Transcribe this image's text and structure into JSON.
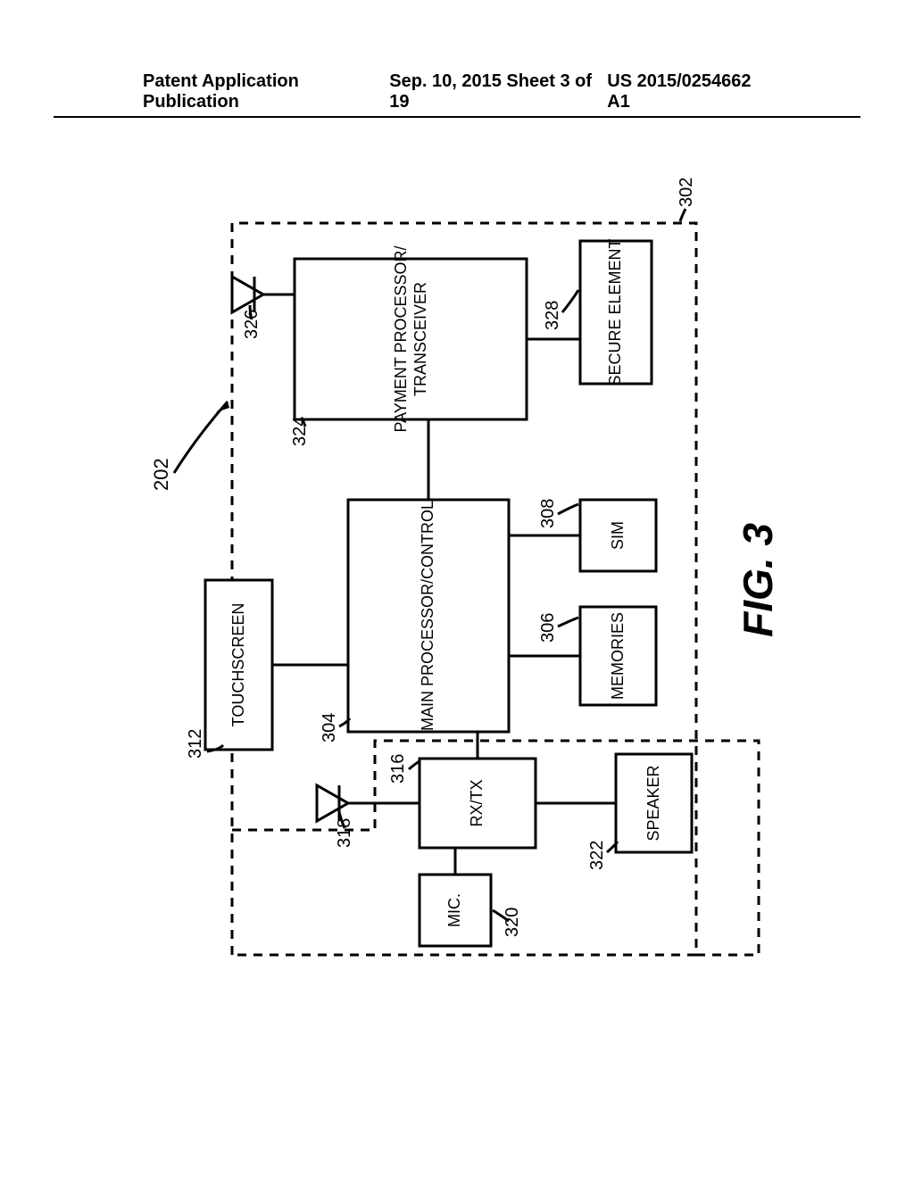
{
  "header": {
    "left": "Patent Application Publication",
    "center": "Sep. 10, 2015  Sheet 3 of 19",
    "right": "US 2015/0254662 A1"
  },
  "figure": {
    "caption": "FIG. 3",
    "overall_ref": "202",
    "sub_ref": "302",
    "blocks": {
      "mic": {
        "label": "MIC.",
        "ref": "320"
      },
      "rxtx": {
        "label": "RX/TX",
        "ref": "316"
      },
      "antenna1_ref": "318",
      "speaker": {
        "label": "SPEAKER",
        "ref": "322"
      },
      "touchscreen": {
        "label": "TOUCHSCREEN",
        "ref": "312"
      },
      "mainproc": {
        "label": "MAIN PROCESSOR/CONTROL",
        "ref": "304"
      },
      "memories": {
        "label": "MEMORIES",
        "ref": "306"
      },
      "sim": {
        "label": "SIM",
        "ref": "308"
      },
      "payproc": {
        "label1": "PAYMENT PROCESSOR/",
        "label2": "TRANSCEIVER",
        "ref": "324"
      },
      "antenna2_ref": "326",
      "secure": {
        "label": "SECURE ELEMENT",
        "ref": "328"
      }
    }
  }
}
